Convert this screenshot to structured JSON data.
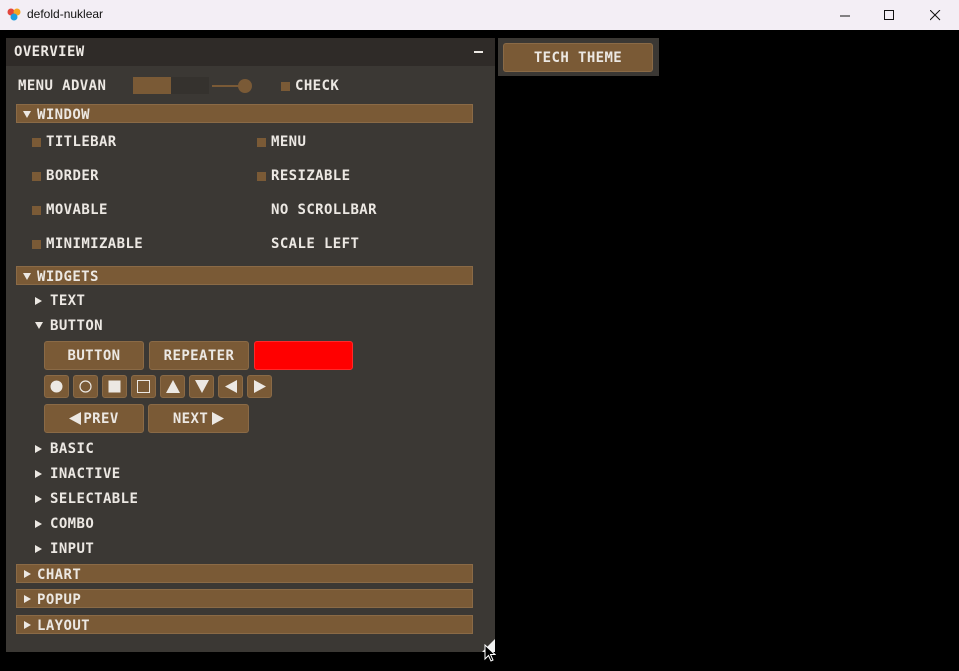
{
  "window": {
    "title": "defold-nuklear"
  },
  "overview": {
    "title": "Overview",
    "minimize_label": "-",
    "menu": {
      "label": "Menu Advan",
      "check_label": "Check"
    },
    "window_section": {
      "label": "Window",
      "options": [
        {
          "label": "Titlebar",
          "checked": true
        },
        {
          "label": "Menu",
          "checked": true
        },
        {
          "label": "Border",
          "checked": true
        },
        {
          "label": "Resizable",
          "checked": true
        },
        {
          "label": "Movable",
          "checked": true
        },
        {
          "label": "No Scrollbar",
          "checked": false
        },
        {
          "label": "Minimizable",
          "checked": true
        },
        {
          "label": "Scale Left",
          "checked": false
        }
      ]
    },
    "widgets_section": {
      "label": "Widgets",
      "text": "Text",
      "button": "Button",
      "buttons": {
        "button": "Button",
        "repeater": "Repeater",
        "color": "#ff0000",
        "prev": "Prev",
        "next": "Next"
      },
      "symbols": [
        "circle-solid",
        "circle-outline",
        "rect-solid",
        "rect-outline",
        "triangle-up",
        "triangle-down",
        "triangle-left",
        "triangle-right"
      ],
      "basic": "Basic",
      "inactive": "Inactive",
      "selectable": "Selectable",
      "combo": "Combo",
      "input": "Input"
    },
    "chart_section": {
      "label": "Chart"
    },
    "popup_section": {
      "label": "Popup"
    },
    "layout_section": {
      "label": "Layout"
    }
  },
  "tech_theme": {
    "label": "Tech Theme"
  },
  "colors": {
    "accent": "#7a5a36",
    "panel": "#3b3834",
    "header": "#2f2b28",
    "text": "#ece8e3"
  }
}
